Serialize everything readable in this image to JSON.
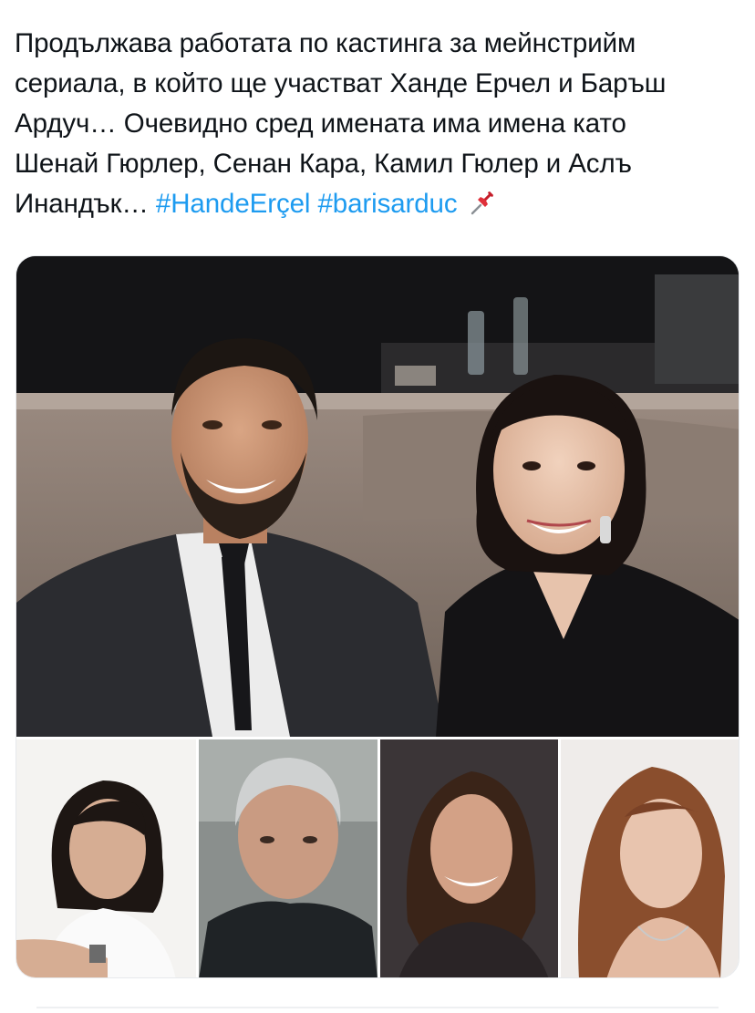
{
  "tweet": {
    "lines": [
      "Продължава работата по кастинга за мейнстрийм",
      "сериала, в който ще участват Ханде Ерчел и Баръш",
      "Ардуч… Очевидно сред имената има имена като",
      "Шенай Гюрлер, Сенан Кара, Камил Гюлер и Аслъ"
    ],
    "last_line_text": "Инандък… ",
    "hashtags": [
      "#HandeErçel",
      "#barisarduc"
    ],
    "emoji_icon": "pushpin-icon"
  },
  "media": {
    "main_photo": "couple-photo",
    "thumbnails": [
      "woman-short-hair-photo",
      "man-grey-hair-photo",
      "woman-dark-hair-photo",
      "woman-long-hair-photo"
    ]
  },
  "colors": {
    "text": "#0f1419",
    "hashtag": "#1d9bf0",
    "border": "#e6e9ec"
  }
}
